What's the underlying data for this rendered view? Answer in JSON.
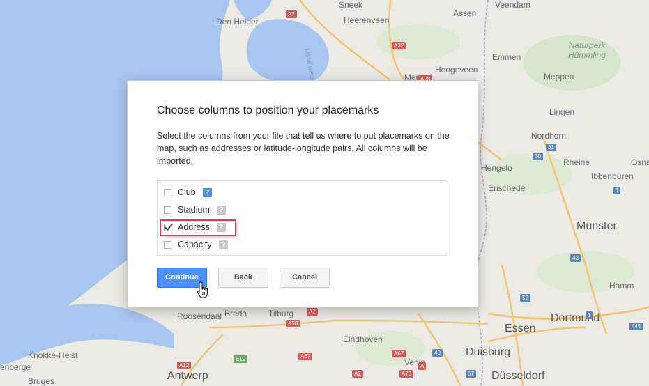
{
  "map": {
    "cities": [
      {
        "id": "sneek",
        "label": "Sneek"
      },
      {
        "id": "assen",
        "label": "Assen"
      },
      {
        "id": "veendam",
        "label": "Veendam"
      },
      {
        "id": "den-helder",
        "label": "Den Helder"
      },
      {
        "id": "heerenveen",
        "label": "Heerenveen"
      },
      {
        "id": "emmen",
        "label": "Emmen"
      },
      {
        "id": "hoogeveen",
        "label": "Hoogeveen"
      },
      {
        "id": "meppel",
        "label": "Meppel"
      },
      {
        "id": "meppen",
        "label": "Meppen"
      },
      {
        "id": "lingen",
        "label": "Lingen"
      },
      {
        "id": "nordhorn",
        "label": "Nordhorn"
      },
      {
        "id": "rheine",
        "label": "Rheine"
      },
      {
        "id": "osna",
        "label": "Osna"
      },
      {
        "id": "ibbenburen",
        "label": "Ibbenbüren"
      },
      {
        "id": "hengelo",
        "label": "Hengelo"
      },
      {
        "id": "enschede",
        "label": "Enschede"
      },
      {
        "id": "munster",
        "label": "Münster"
      },
      {
        "id": "hamm",
        "label": "Hamm"
      },
      {
        "id": "dortmund",
        "label": "Dortmund"
      },
      {
        "id": "essen",
        "label": "Essen"
      },
      {
        "id": "duisburg",
        "label": "Duisburg"
      },
      {
        "id": "dusseldorf",
        "label": "Düsseldorf"
      },
      {
        "id": "venlo",
        "label": "Venlo"
      },
      {
        "id": "eindhoven",
        "label": "Eindhoven"
      },
      {
        "id": "tilburg",
        "label": "Tilburg"
      },
      {
        "id": "breda",
        "label": "Breda"
      },
      {
        "id": "roosendaal",
        "label": "Roosendaal"
      },
      {
        "id": "antwerp",
        "label": "Antwerp"
      },
      {
        "id": "knokke-heist",
        "label": "Knokke-Heist"
      },
      {
        "id": "enberge",
        "label": "enberge"
      },
      {
        "id": "bruges",
        "label": "Bruges"
      },
      {
        "id": "ijsselmeer",
        "label": "IJsselmeer"
      }
    ],
    "park_label": "Naturpark\nHümmling",
    "roads": [
      "A7",
      "A32",
      "A28",
      "31",
      "30",
      "1",
      "43",
      "52",
      "445",
      "1",
      "A2",
      "A58",
      "A67",
      "A67",
      "A73",
      "A12",
      "E19",
      "40",
      "A2",
      "57",
      "A"
    ]
  },
  "dialog": {
    "title": "Choose columns to position your placemarks",
    "description": "Select the columns from your file that tell us where to put placemarks on the map, such as addresses or latitude-longitude pairs. All columns will be imported.",
    "columns": [
      {
        "label": "Club",
        "checked": false,
        "help": "?"
      },
      {
        "label": "Stadium",
        "checked": false,
        "help": "?"
      },
      {
        "label": "Address",
        "checked": true,
        "help": "?"
      },
      {
        "label": "Capacity",
        "checked": false,
        "help": "?"
      }
    ],
    "buttons": {
      "continue": "Continue",
      "back": "Back",
      "cancel": "Cancel"
    }
  },
  "colors": {
    "primary_button": "#4d90fe",
    "highlight": "#e04141",
    "help_active": "#4a90e2",
    "sea": "#a9c6f0"
  }
}
